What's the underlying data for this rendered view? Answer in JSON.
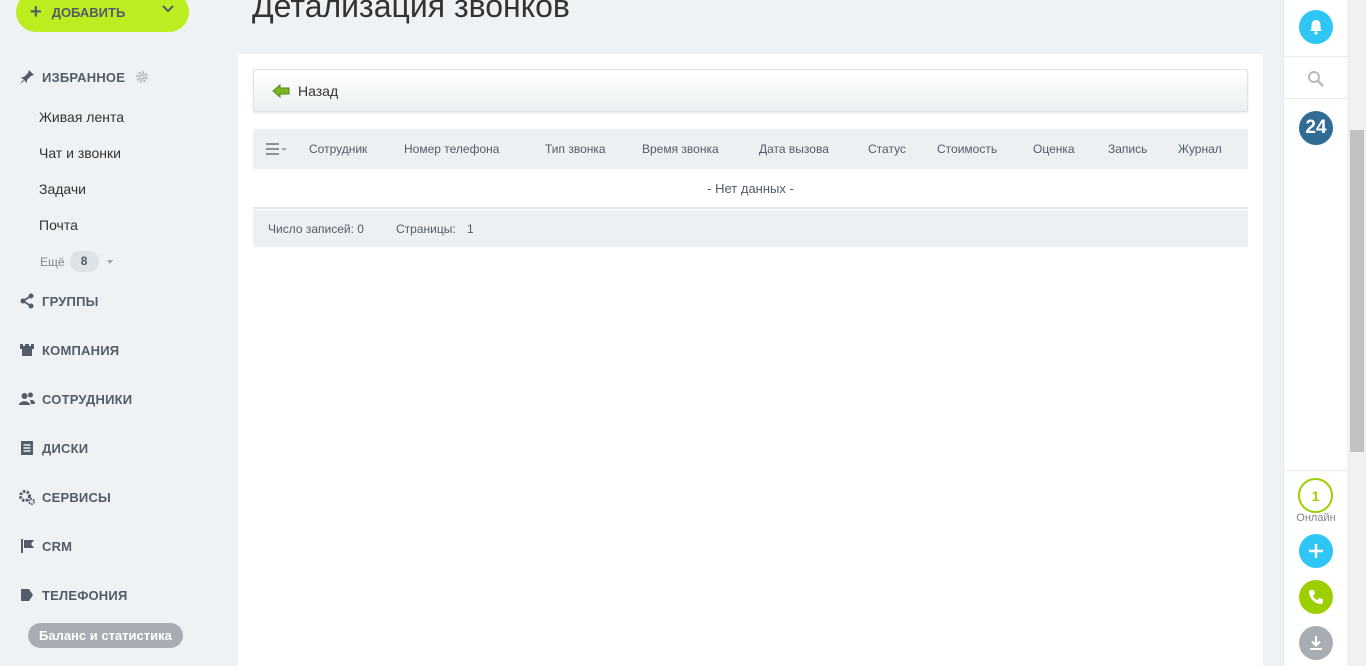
{
  "sidebar": {
    "add_label": "ДОБАВИТЬ",
    "favorites_label": "ИЗБРАННОЕ",
    "items": [
      {
        "label": "Живая лента"
      },
      {
        "label": "Чат и звонки"
      },
      {
        "label": "Задачи"
      },
      {
        "label": "Почта"
      }
    ],
    "more_label": "Ещё",
    "more_count": "8",
    "sections": [
      {
        "label": "ГРУППЫ"
      },
      {
        "label": "КОМПАНИЯ"
      },
      {
        "label": "СОТРУДНИКИ"
      },
      {
        "label": "ДИСКИ"
      },
      {
        "label": "СЕРВИСЫ"
      },
      {
        "label": "CRM"
      },
      {
        "label": "ТЕЛЕФОНИЯ"
      }
    ],
    "balance_label": "Баланс и статистика"
  },
  "main": {
    "title": "Детализация звонков",
    "back_label": "Назад",
    "columns": [
      "Сотрудник",
      "Номер телефона",
      "Тип звонка",
      "Время звонка",
      "Дата вызова",
      "Статус",
      "Стоимость",
      "Оценка",
      "Запись",
      "Журнал"
    ],
    "empty_text": "- Нет данных -",
    "footer_count": "Число записей: 0",
    "footer_pages_label": "Страницы:",
    "footer_page": "1"
  },
  "right_panel": {
    "counter_24": "24",
    "online_count": "1",
    "online_label": "Онлайн"
  },
  "colors": {
    "accent_green": "#bbed21",
    "notify_blue": "#2fc6f6",
    "b24_dark": "#2f6b93",
    "phone_green": "#9dcf00",
    "download_gray": "#a7adb3"
  }
}
